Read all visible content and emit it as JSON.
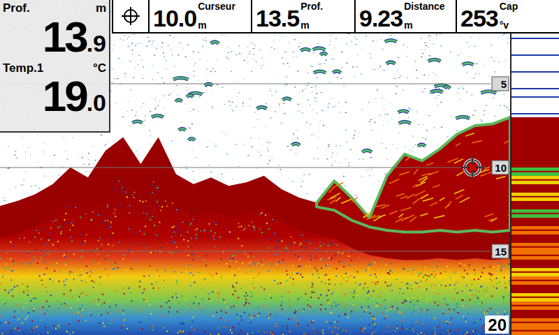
{
  "top_bar": {
    "fields": [
      {
        "value": "10.0",
        "unit": "m",
        "label": "Curseur"
      },
      {
        "value": "13.5",
        "unit": "m",
        "label": "Prof."
      },
      {
        "value": "9.23",
        "unit": "m",
        "label": "Distance"
      },
      {
        "value": "253",
        "unit": "°v",
        "label": "Cap"
      }
    ]
  },
  "readouts": [
    {
      "label": "Prof.",
      "unit": "m",
      "whole": "13",
      "decimal": ".9"
    },
    {
      "label": "Temp.1",
      "unit": "°C",
      "whole": "19",
      "decimal": ".0"
    }
  ],
  "sonar": {
    "depth_ticks": [
      "5",
      "10",
      "15"
    ],
    "max_depth": "20",
    "bottom_depth": [
      12.3,
      12.0,
      11.6,
      11.0,
      10.0,
      10.6,
      9.0,
      8.2,
      9.8,
      8.2,
      10.4,
      11.0,
      10.6,
      11.1,
      10.9,
      10.5,
      11.3,
      11.8,
      12.1,
      12.3,
      12.9,
      13.3,
      13.5,
      13.6,
      13.6,
      13.5,
      13.6,
      13.5,
      13.6,
      13.5
    ],
    "structure_top": [
      12.3,
      12.0,
      11.6,
      11.0,
      10.0,
      10.6,
      9.0,
      8.2,
      9.8,
      8.2,
      10.4,
      11.0,
      10.6,
      11.1,
      10.9,
      10.5,
      11.3,
      11.8,
      12.1,
      10.8,
      11.8,
      13.0,
      10.5,
      9.2,
      9.6,
      8.9,
      8.0,
      7.5,
      7.4,
      7.0
    ]
  },
  "flasher": {
    "intensity": [
      0.5,
      0.3,
      0.5,
      0.2,
      0.15,
      0,
      0.2,
      0,
      0.15,
      0,
      0.1,
      0.2,
      0,
      0.25,
      1,
      1,
      1,
      1,
      0.95,
      1,
      0.6,
      0.7,
      1,
      0.65,
      1,
      0.55,
      1,
      0.9,
      1,
      0.85,
      0.8,
      1,
      0.7,
      0.9,
      1,
      0.75,
      0.85,
      0.95,
      0.8,
      0.9
    ]
  }
}
